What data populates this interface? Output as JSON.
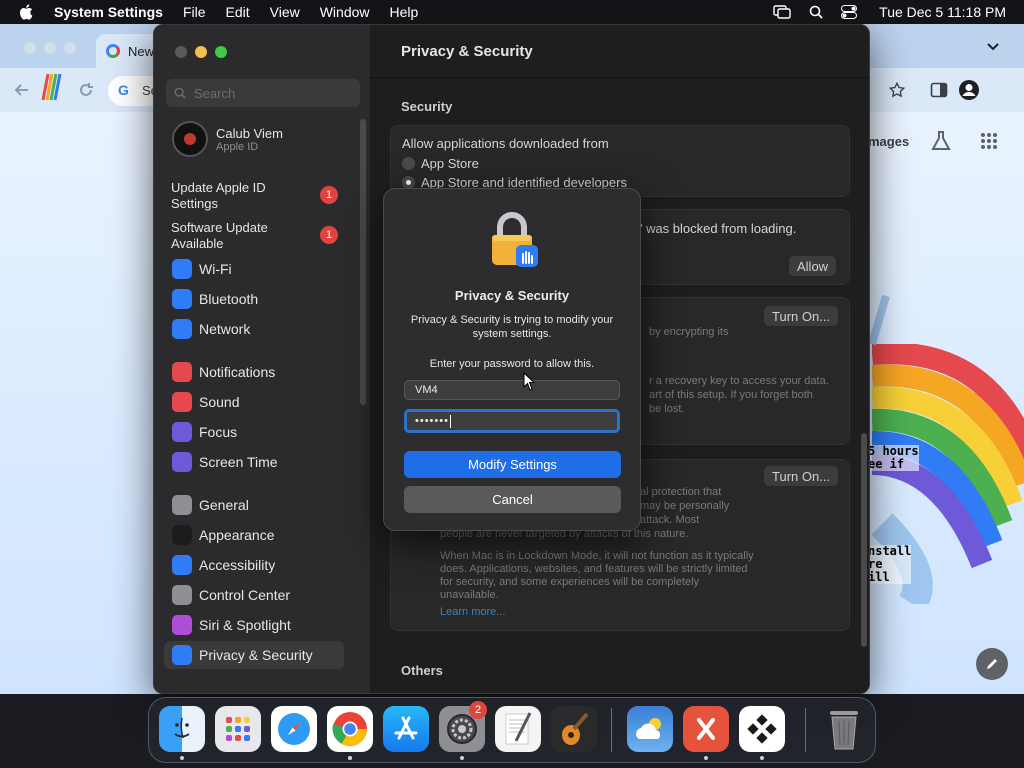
{
  "menubar": {
    "app_name": "System Settings",
    "items": [
      "File",
      "Edit",
      "View",
      "Window",
      "Help"
    ],
    "clock": "Tue Dec 5  11:18 PM"
  },
  "chrome": {
    "tab_title": "New",
    "omnibox_partial": "Se",
    "images_link": "mages",
    "overlay_text_1": "5 hours\nee if",
    "overlay_text_2": "nstall\nre\nill"
  },
  "settings": {
    "window_title": "Privacy & Security",
    "search_placeholder": "Search",
    "account": {
      "name": "Calub Viem",
      "subtitle": "Apple ID"
    },
    "notifications": [
      {
        "label": "Update Apple ID Settings",
        "badge": "1"
      },
      {
        "label": "Software Update Available",
        "badge": "1"
      }
    ],
    "sidebar_items": [
      {
        "label": "Wi-Fi",
        "icon": "wifi-icon",
        "color": "#2f7cf6"
      },
      {
        "label": "Bluetooth",
        "icon": "bluetooth-icon",
        "color": "#2f7cf6"
      },
      {
        "label": "Network",
        "icon": "globe-icon",
        "color": "#2f7cf6"
      },
      {
        "label": "Notifications",
        "icon": "bell-icon",
        "color": "#e5484d"
      },
      {
        "label": "Sound",
        "icon": "speaker-icon",
        "color": "#e5484d"
      },
      {
        "label": "Focus",
        "icon": "moon-icon",
        "color": "#6e5ad8"
      },
      {
        "label": "Screen Time",
        "icon": "hourglass-icon",
        "color": "#6e5ad8"
      },
      {
        "label": "General",
        "icon": "gear-icon",
        "color": "#8e8e93"
      },
      {
        "label": "Appearance",
        "icon": "appearance-icon",
        "color": "#1c1c1e"
      },
      {
        "label": "Accessibility",
        "icon": "accessibility-icon",
        "color": "#2f7cf6"
      },
      {
        "label": "Control Center",
        "icon": "control-center-icon",
        "color": "#8e8e93"
      },
      {
        "label": "Siri & Spotlight",
        "icon": "siri-icon",
        "color": "#b04dd6"
      },
      {
        "label": "Privacy & Security",
        "icon": "hand-icon",
        "color": "#2f7cf6"
      }
    ],
    "content": {
      "security_header": "Security",
      "allow_label": "Allow applications downloaded from",
      "radio_app_store": "App Store",
      "radio_identified": "App Store and identified developers",
      "blocked_text": "et\" was blocked from loading.",
      "allow_button": "Allow",
      "turn_on_1": "Turn On...",
      "filevault_partial_1": "by encrypting its",
      "filevault_partial_2": "r a recovery key to access your data.",
      "filevault_partial_3": "art of this setup. If you forget both",
      "filevault_partial_4": "be lost.",
      "turn_on_2": "Turn On...",
      "lockdown_partial_1": "al protection that",
      "lockdown_partial_2": "may be personally",
      "lockdown_partial_3": "attack. Most",
      "lockdown_partial_4": "people are never targeted by attacks of this nature.",
      "lockdown_desc": "When Mac is in Lockdown Mode, it will not function as it typically does. Applications, websites, and features will be strictly limited for security, and some experiences will be completely unavailable.",
      "learn_more": "Learn more...",
      "others_header": "Others"
    }
  },
  "dialog": {
    "title": "Privacy & Security",
    "message": "Privacy & Security is trying to modify your system settings.",
    "prompt": "Enter your password to allow this.",
    "username": "VM4",
    "password_mask": "•••••••",
    "primary_button": "Modify Settings",
    "cancel_button": "Cancel"
  },
  "dock": {
    "apps": [
      {
        "name": "finder-icon"
      },
      {
        "name": "launchpad-icon"
      },
      {
        "name": "safari-icon"
      },
      {
        "name": "chrome-icon"
      },
      {
        "name": "app-store-icon"
      },
      {
        "name": "system-settings-icon"
      },
      {
        "name": "textedit-icon"
      },
      {
        "name": "garageband-icon"
      },
      {
        "name": "weather-icon"
      },
      {
        "name": "remote-desktop-icon"
      },
      {
        "name": "anydesk-icon"
      },
      {
        "name": "trash-icon"
      }
    ],
    "settings_badge": "2"
  }
}
